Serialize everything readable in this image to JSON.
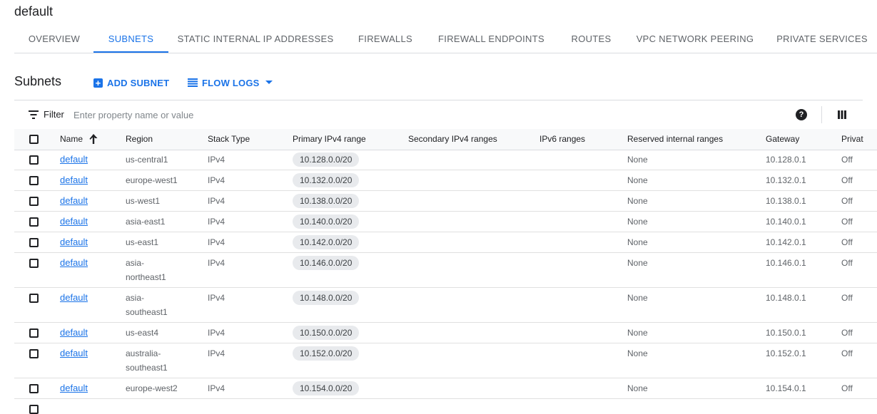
{
  "page": {
    "title": "default"
  },
  "tabs": [
    {
      "label": "OVERVIEW",
      "active": false
    },
    {
      "label": "SUBNETS",
      "active": true
    },
    {
      "label": "STATIC INTERNAL IP ADDRESSES",
      "active": false
    },
    {
      "label": "FIREWALLS",
      "active": false
    },
    {
      "label": "FIREWALL ENDPOINTS",
      "active": false
    },
    {
      "label": "ROUTES",
      "active": false
    },
    {
      "label": "VPC NETWORK PEERING",
      "active": false
    },
    {
      "label": "PRIVATE SERVICES",
      "active": false
    }
  ],
  "section": {
    "title": "Subnets",
    "add_label": "ADD SUBNET",
    "flow_logs_label": "FLOW LOGS"
  },
  "filter": {
    "label": "Filter",
    "placeholder": "Enter property name or value"
  },
  "table": {
    "headers": {
      "name": "Name",
      "region": "Region",
      "stack": "Stack Type",
      "primary": "Primary IPv4 range",
      "secondary": "Secondary IPv4 ranges",
      "ipv6": "IPv6 ranges",
      "reserved": "Reserved internal ranges",
      "gateway": "Gateway",
      "private": "Privat"
    },
    "rows": [
      {
        "name": "default",
        "region": "us-central1",
        "stack": "IPv4",
        "primary": "10.128.0.0/20",
        "reserved": "None",
        "gateway": "10.128.0.1",
        "private": "Off"
      },
      {
        "name": "default",
        "region": "europe-west1",
        "stack": "IPv4",
        "primary": "10.132.0.0/20",
        "reserved": "None",
        "gateway": "10.132.0.1",
        "private": "Off"
      },
      {
        "name": "default",
        "region": "us-west1",
        "stack": "IPv4",
        "primary": "10.138.0.0/20",
        "reserved": "None",
        "gateway": "10.138.0.1",
        "private": "Off"
      },
      {
        "name": "default",
        "region": "asia-east1",
        "stack": "IPv4",
        "primary": "10.140.0.0/20",
        "reserved": "None",
        "gateway": "10.140.0.1",
        "private": "Off"
      },
      {
        "name": "default",
        "region": "us-east1",
        "stack": "IPv4",
        "primary": "10.142.0.0/20",
        "reserved": "None",
        "gateway": "10.142.0.1",
        "private": "Off"
      },
      {
        "name": "default",
        "region": "asia-northeast1",
        "region_lines": [
          "asia-",
          "northeast1"
        ],
        "stack": "IPv4",
        "primary": "10.146.0.0/20",
        "reserved": "None",
        "gateway": "10.146.0.1",
        "private": "Off"
      },
      {
        "name": "default",
        "region": "asia-southeast1",
        "region_lines": [
          "asia-",
          "southeast1"
        ],
        "stack": "IPv4",
        "primary": "10.148.0.0/20",
        "reserved": "None",
        "gateway": "10.148.0.1",
        "private": "Off"
      },
      {
        "name": "default",
        "region": "us-east4",
        "stack": "IPv4",
        "primary": "10.150.0.0/20",
        "reserved": "None",
        "gateway": "10.150.0.1",
        "private": "Off"
      },
      {
        "name": "default",
        "region": "australia-southeast1",
        "region_lines": [
          "australia-",
          "southeast1"
        ],
        "stack": "IPv4",
        "primary": "10.152.0.0/20",
        "reserved": "None",
        "gateway": "10.152.0.1",
        "private": "Off"
      },
      {
        "name": "default",
        "region": "europe-west2",
        "stack": "IPv4",
        "primary": "10.154.0.0/20",
        "reserved": "None",
        "gateway": "10.154.0.1",
        "private": "Off"
      }
    ]
  },
  "icons": {
    "add": "add-box-icon",
    "flow_logs": "list-lines-icon",
    "dropdown": "caret-down-icon",
    "filter": "filter-icon",
    "help": "help-circle-icon",
    "columns": "column-display-icon",
    "sort": "arrow-up-icon"
  },
  "colors": {
    "accent": "#1a73e8",
    "text": "#202124",
    "muted": "#5f6368",
    "chip": "#e8eaed"
  }
}
